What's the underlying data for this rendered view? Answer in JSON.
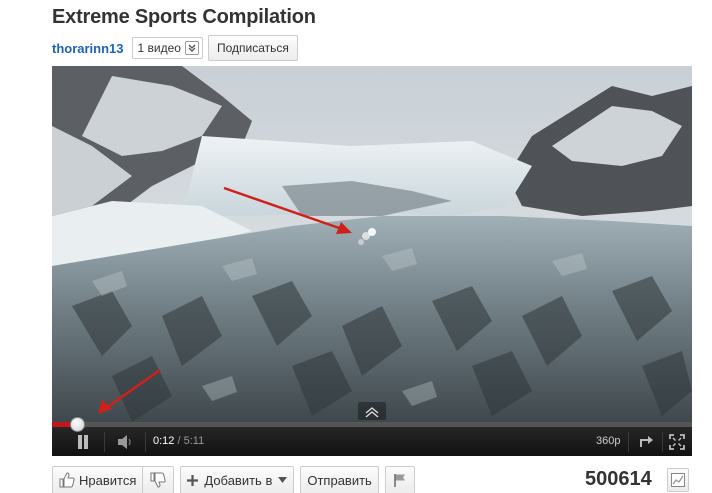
{
  "video": {
    "title": "Extreme Sports Compilation"
  },
  "channel": {
    "name": "thorarinn13",
    "video_count_label": "1 видео",
    "subscribe_label": "Подписаться"
  },
  "player": {
    "current_time": "0:12",
    "time_separator": " / ",
    "duration": "5:11",
    "quality": "360p",
    "progress_fraction": 0.0386,
    "accent_color": "#c8151d",
    "icons": [
      "pause-icon",
      "volume-icon",
      "expand-icon",
      "popout-icon",
      "fullscreen-icon"
    ]
  },
  "actions": {
    "like_label": "Нравится",
    "add_label": "Добавить в",
    "share_label": "Отправить",
    "icons": [
      "thumbs-up-icon",
      "thumbs-down-icon",
      "plus-icon",
      "chevron-down-icon",
      "flag-icon",
      "stats-icon"
    ]
  },
  "views": {
    "count": "500614"
  },
  "colors": {
    "link": "#1c62b9",
    "annotation_arrow": "#d0201a"
  }
}
